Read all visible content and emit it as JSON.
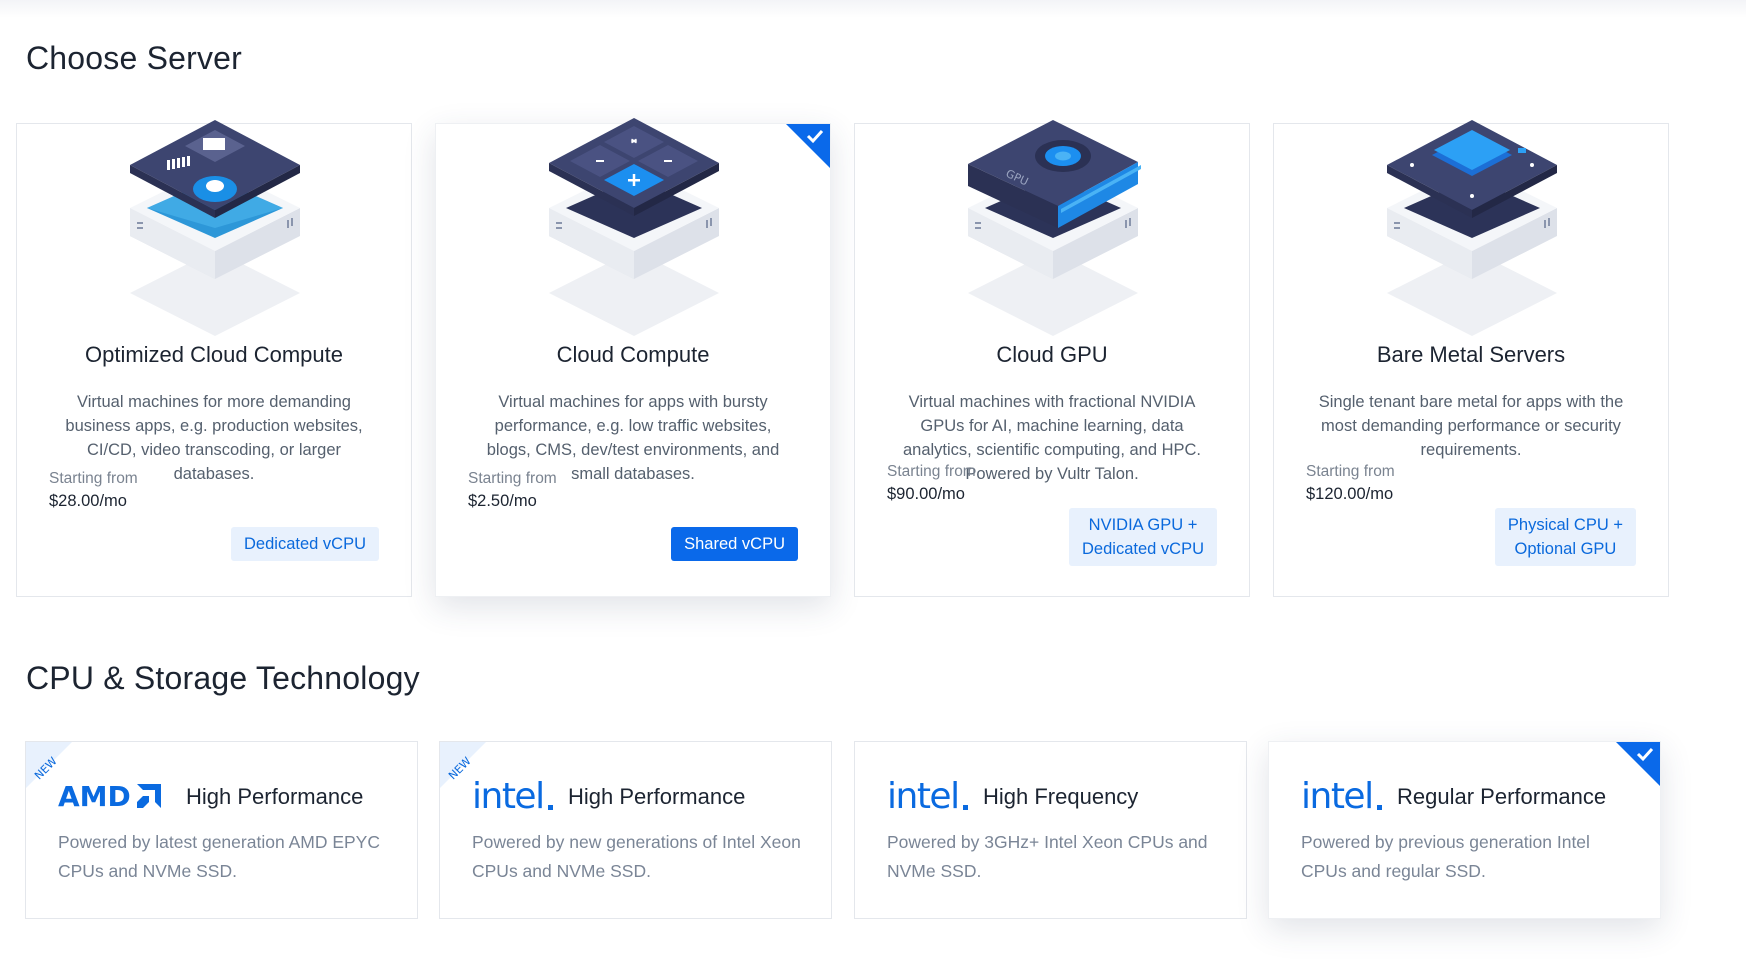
{
  "sections": {
    "server_title": "Choose Server",
    "cpu_title": "CPU & Storage Technology"
  },
  "server_cards": [
    {
      "name": "Optimized Cloud Compute",
      "desc": "Virtual machines for more demanding business apps, e.g. production websites, CI/CD, video transcoding, or larger databases.",
      "start_label": "Starting from",
      "price": "$28.00/mo",
      "badge": "Dedicated vCPU",
      "selected": false
    },
    {
      "name": "Cloud Compute",
      "desc": "Virtual machines for apps with bursty performance, e.g. low traffic websites, blogs, CMS, dev/test environments, and small databases.",
      "start_label": "Starting from",
      "price": "$2.50/mo",
      "badge": "Shared vCPU",
      "selected": true
    },
    {
      "name": "Cloud GPU",
      "desc": "Virtual machines with fractional NVIDIA GPUs for AI, machine learning, data analytics, scientific computing, and HPC. Powered by Vultr Talon.",
      "start_label": "Starting from",
      "price": "$90.00/mo",
      "badge_line1": "NVIDIA GPU +",
      "badge_line2": "Dedicated vCPU",
      "selected": false
    },
    {
      "name": "Bare Metal Servers",
      "desc": "Single tenant bare metal for apps with the most demanding performance or security requirements.",
      "start_label": "Starting from",
      "price": "$120.00/mo",
      "badge_line1": "Physical CPU +",
      "badge_line2": "Optional GPU",
      "selected": false
    }
  ],
  "tech_cards": [
    {
      "logo": "AMD",
      "title": "High Performance",
      "desc": "Powered by latest generation AMD EPYC CPUs and NVMe SSD.",
      "ribbon": "NEW",
      "selected": false
    },
    {
      "logo": "intel",
      "title": "High Performance",
      "desc": "Powered by new generations of Intel Xeon CPUs and NVMe SSD.",
      "ribbon": "NEW",
      "selected": false
    },
    {
      "logo": "intel",
      "title": "High Frequency",
      "desc": "Powered by 3GHz+ Intel Xeon CPUs and NVMe SSD.",
      "selected": false
    },
    {
      "logo": "intel",
      "title": "Regular Performance",
      "desc": "Powered by previous generation Intel CPUs and regular SSD.",
      "selected": true
    }
  ],
  "colors": {
    "accent": "#0a69ea",
    "badge_bg": "#e8f1fd",
    "text_dark": "#1c2431",
    "text_muted": "#55606e"
  },
  "icons": {
    "check": "checkmark-icon",
    "server_illustrations": [
      "optimized-compute-icon",
      "cloud-compute-icon",
      "gpu-icon",
      "bare-metal-icon"
    ]
  }
}
